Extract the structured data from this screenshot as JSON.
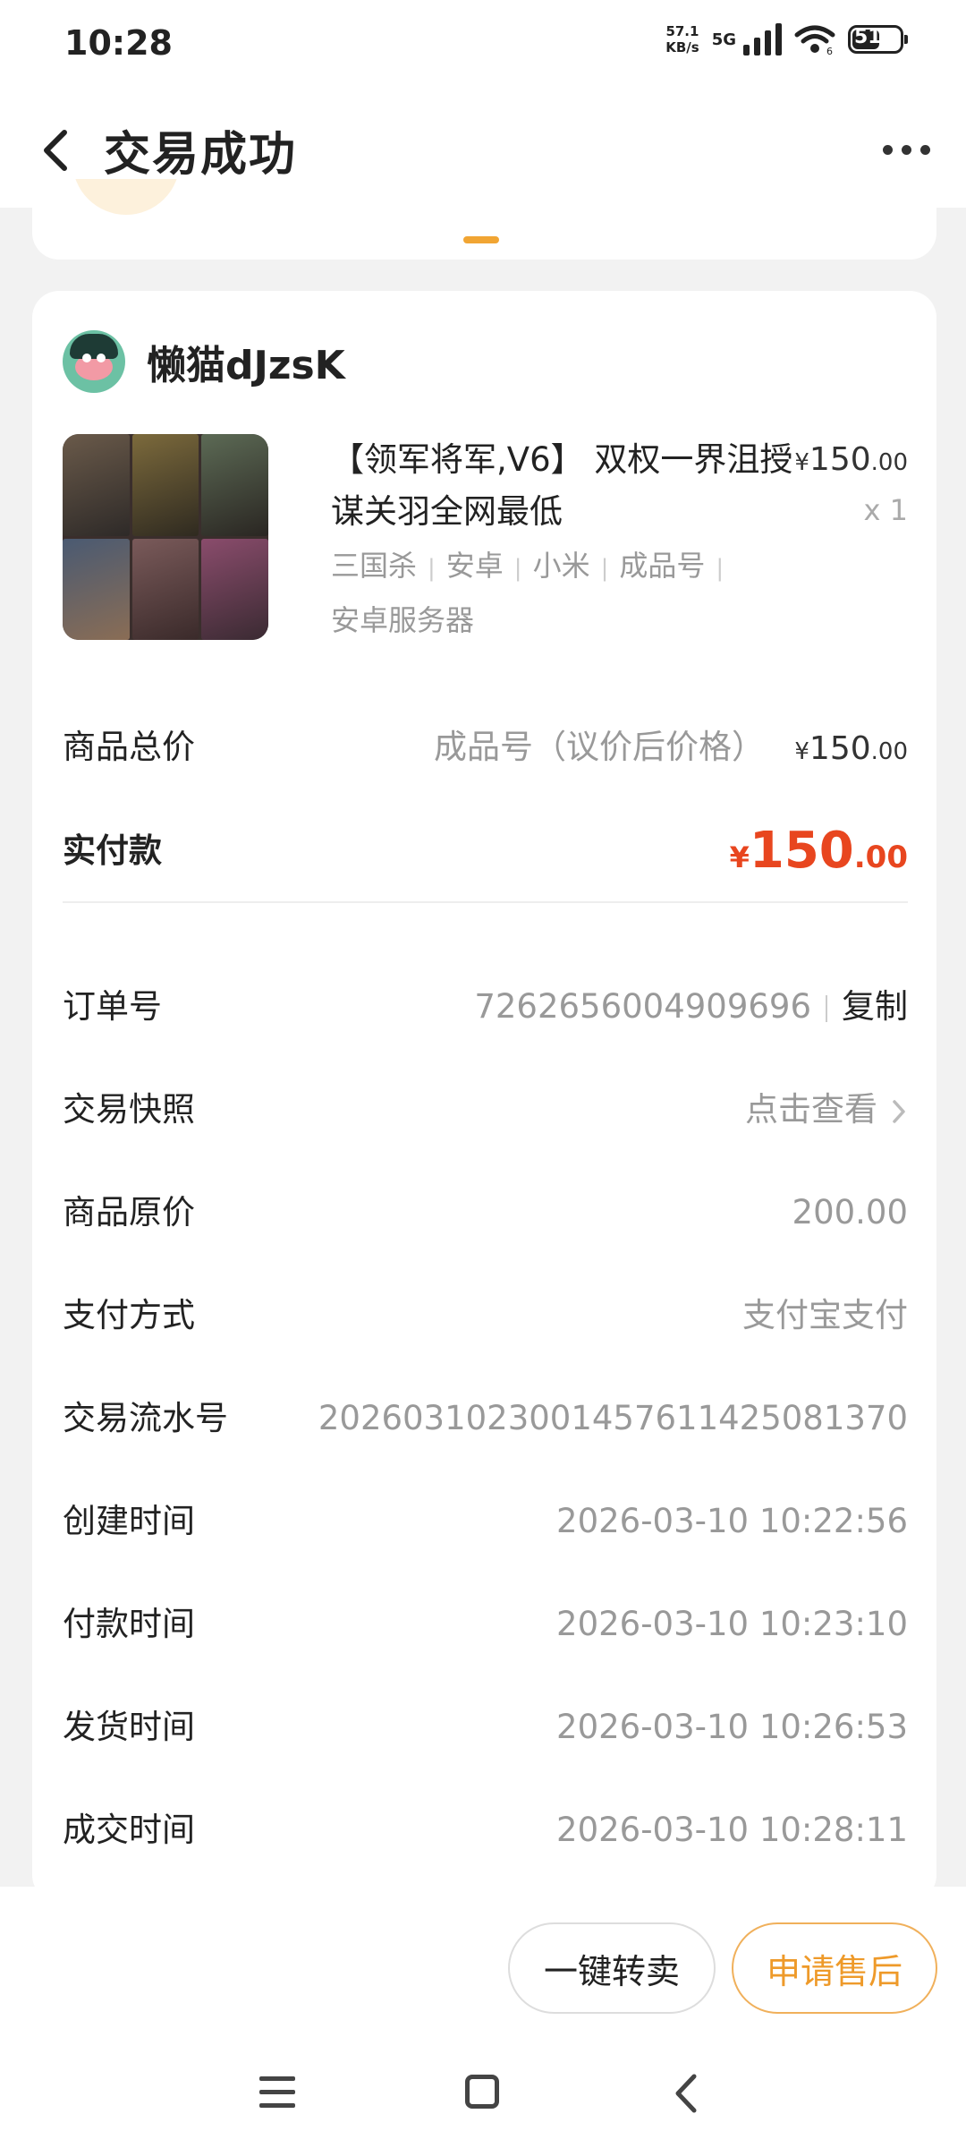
{
  "status_bar": {
    "time": "10:28",
    "net_speed_value": "57.1",
    "net_speed_unit": "KB/s",
    "network": "5G",
    "battery": "51",
    "wifi_sub": "6"
  },
  "header": {
    "title": "交易成功",
    "back_icon": "chevron-left-icon",
    "more_icon": "more-dots-icon"
  },
  "seller": {
    "name": "懒猫dJzsK",
    "avatar_icon": "avatar"
  },
  "product": {
    "title": "【领军将军,V6】 双权一界沮授谋关羽全网最低",
    "tags": [
      "三国杀",
      "安卓",
      "小米",
      "成品号"
    ],
    "tag_line2": "安卓服务器",
    "price_symbol": "¥",
    "price_int": "150",
    "price_dec": ".00",
    "quantity": "x 1"
  },
  "summary": {
    "total_label": "商品总价",
    "total_note": "成品号（议价后价格）",
    "total_symbol": "¥",
    "total_int": "150",
    "total_dec": ".00",
    "paid_label": "实付款",
    "paid_symbol": "¥",
    "paid_int": "150",
    "paid_dec": ".00"
  },
  "details": {
    "order_label": "订单号",
    "order_value": "7262656004909696",
    "copy_label": "复制",
    "snapshot_label": "交易快照",
    "snapshot_value": "点击查看",
    "original_price_label": "商品原价",
    "original_price_value": "200.00",
    "payment_label": "支付方式",
    "payment_value": "支付宝支付",
    "serial_label": "交易流水号",
    "serial_value": "2026031023001457611425081370",
    "created_label": "创建时间",
    "created_value": "2026-03-10 10:22:56",
    "paid_time_label": "付款时间",
    "paid_time_value": "2026-03-10 10:23:10",
    "shipped_label": "发货时间",
    "shipped_value": "2026-03-10 10:26:53",
    "completed_label": "成交时间",
    "completed_value": "2026-03-10 10:28:11"
  },
  "actions": {
    "resell_label": "一键转卖",
    "aftersale_label": "申请售后"
  },
  "colors": {
    "accent_orange": "#ee9a2a",
    "price_red": "#e8461f",
    "background": "#f2f2f2"
  }
}
